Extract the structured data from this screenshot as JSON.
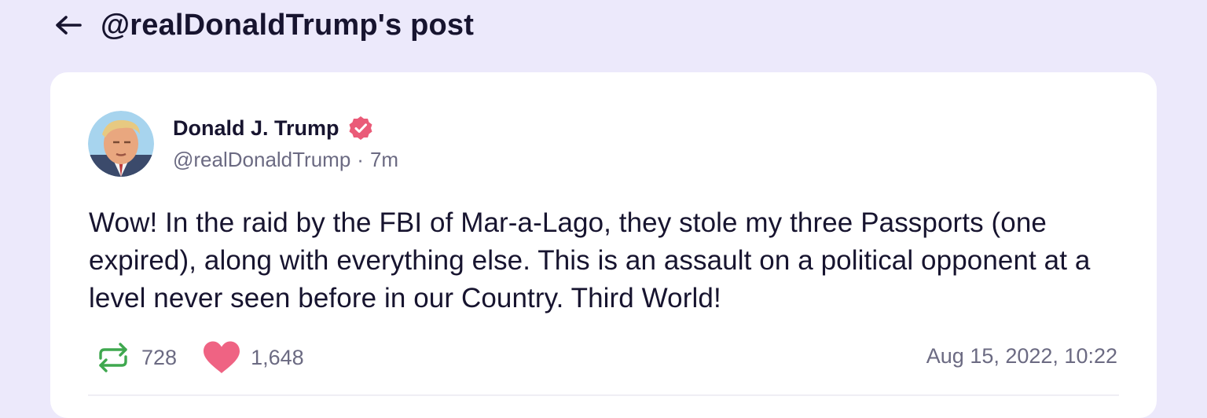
{
  "header": {
    "title": "@realDonaldTrump's post",
    "back_icon": "arrow-left-icon"
  },
  "post": {
    "author_name": "Donald J. Trump",
    "verified_icon": "verified-badge-icon",
    "handle": "@realDonaldTrump",
    "separator": "·",
    "relative_time": "7m",
    "text": "Wow! In the raid by the FBI of Mar-a-Lago, they stole my three Passports (one expired), along with everything else. This is an assault on a political opponent at a level never seen before in our Country. Third World!",
    "reposts": "728",
    "likes": "1,648",
    "timestamp": "Aug 15, 2022, 10:22"
  },
  "colors": {
    "background": "#ece9fb",
    "card": "#ffffff",
    "verified": "#ea5b78",
    "repost": "#3fa84f",
    "like": "#ef6383",
    "muted_text": "#6b6a82",
    "primary_text": "#17142f"
  }
}
